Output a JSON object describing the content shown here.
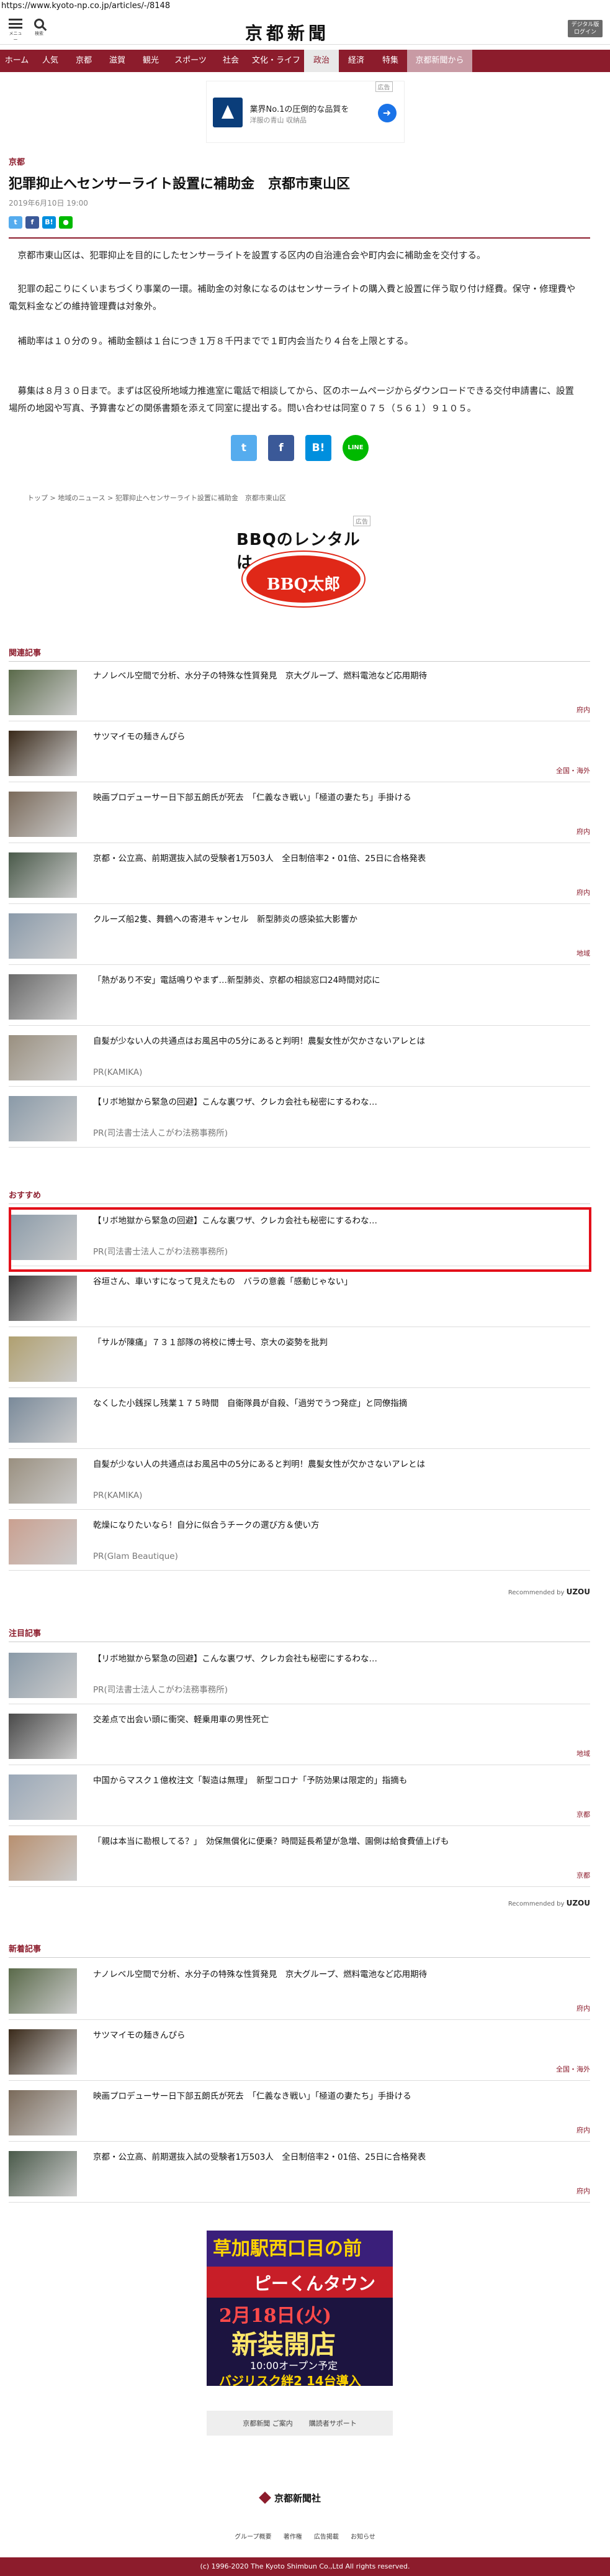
{
  "url": "https://www.kyoto-np.co.jp/articles/-/8148",
  "header": {
    "menu_label": "メニュー",
    "search_label": "検索",
    "logo": "京都新聞",
    "login_line1": "デジタル版",
    "login_line2": "ログイン"
  },
  "nav": [
    {
      "label": "ホーム",
      "w": 54
    },
    {
      "label": "人気",
      "w": 54
    },
    {
      "label": "京都",
      "w": 54
    },
    {
      "label": "滋賀",
      "w": 54
    },
    {
      "label": "観光",
      "w": 54
    },
    {
      "label": "スポーツ",
      "w": 74
    },
    {
      "label": "社会",
      "w": 56
    },
    {
      "label": "文化・ライフ",
      "w": 90
    },
    {
      "label": "政治",
      "w": 56,
      "active": true
    },
    {
      "label": "経済",
      "w": 56
    },
    {
      "label": "特集",
      "w": 54
    },
    {
      "label": "京都新聞から",
      "w": 105,
      "special": true
    }
  ],
  "ad_top": {
    "tag": "広告",
    "line1": "業界No.1の圧倒的な品質を",
    "line2": "洋服の青山 収納品"
  },
  "article": {
    "category": "京都",
    "title": "犯罪抑止へセンサーライト設置に補助金　京都市東山区",
    "date": "2019年6月10日 19:00",
    "paragraphs": [
      "京都市東山区は、犯罪抑止を目的にしたセンサーライトを設置する区内の自治連合会や町内会に補助金を交付する。",
      "犯罪の起こりにくいまちづくり事業の一環。補助金の対象になるのはセンサーライトの購入費と設置に伴う取り付け経費。保守・修理費や電気料金などの維持管理費は対象外。",
      "補助率は１０分の９。補助金額は１台につき１万８千円までで１町内会当たり４台を上限とする。",
      "募集は８月３０日まで。まずは区役所地域力推進室に電話で相談してから、区のホームページからダウンロードできる交付申請書に、設置場所の地図や写真、予算書などの関係書類を添えて同室に提出する。問い合わせは同室０７５（５６１）９１０５。"
    ]
  },
  "share": {
    "twitter": "t",
    "facebook": "f",
    "hatena": "B!",
    "line": "LINE"
  },
  "breadcrumb": [
    "トップ",
    "地域のニュース",
    "犯罪抑止へセンサーライト設置に補助金　京都市東山区"
  ],
  "bbq_ad": {
    "tag": "広告",
    "title": "BBQのレンタルは",
    "brand": "BBQ太郎"
  },
  "related": {
    "heading": "関連記事",
    "items": [
      {
        "text": "ナノレベル空間で分析、水分子の特殊な性質発見　京大グループ、燃料電池など応用期待",
        "tag": "府内",
        "color": "#5a6a4a"
      },
      {
        "text": "サツマイモの麺きんぴら",
        "tag": "全国・海外",
        "color": "#3a2a1a"
      },
      {
        "text": "映画プロデューサー日下部五朗氏が死去　「仁義なき戦い」「極道の妻たち」手掛ける",
        "tag": "府内",
        "color": "#7a6a5a"
      },
      {
        "text": "京都・公立高、前期選抜入試の受験者1万503人　全日制倍率2・01倍、25日に合格発表",
        "tag": "府内",
        "color": "#4a5a4a"
      },
      {
        "text": "クルーズ船2隻、舞鶴への寄港キャンセル　新型肺炎の感染拡大影響か",
        "tag": "地域",
        "color": "#8a9aaa"
      },
      {
        "text": "「熱があり不安」電話鳴りやまず…新型肺炎、京都の相談窓口24時間対応に",
        "tag": "",
        "color": "#6a6a6a"
      },
      {
        "text": "自髪が少ない人の共通点はお風呂中の5分にあると判明！農髪女性が欠かさないアレとは",
        "pr": "PR(KAMIKA)",
        "color": "#9a9080"
      },
      {
        "text": "【リボ地獄から緊急の回避】こんな裏ワザ、クレカ会社も秘密にするわな…",
        "pr": "PR(司法書士法人こがわ法務事務所)",
        "color": "#8a9aa8"
      }
    ]
  },
  "recommend": {
    "heading": "おすすめ",
    "items": [
      {
        "text": "【リボ地獄から緊急の回避】こんな裏ワザ、クレカ会社も秘密にするわな…",
        "pr": "PR(司法書士法人こがわ法務事務所)",
        "color": "#8a9aa8",
        "highlight": true
      },
      {
        "text": "谷垣さん、車いすになって見えたもの　バラの意義「感動じゃない」",
        "color": "#3a3a3a"
      },
      {
        "text": "「サルが陳痛」７３１部隊の将校に博士号、京大の姿勢を批判",
        "color": "#b0a070"
      },
      {
        "text": "なくした小銭探し残業１７５時間　自衛隊員が自殺、「過労でうつ発症」と同僚指摘",
        "color": "#7a8a9a"
      },
      {
        "text": "自髪が少ない人の共通点はお風呂中の5分にあると判明！農髪女性が欠かさないアレとは",
        "pr": "PR(KAMIKA)",
        "color": "#9a9080"
      },
      {
        "text": "乾燥になりたいなら！自分に似合うチークの選び方＆使い方",
        "pr": "PR(Glam Beautique)",
        "color": "#caa090"
      }
    ],
    "reco": "Recommended by",
    "reco_brand": "UZOU"
  },
  "attention": {
    "heading": "注目記事",
    "items": [
      {
        "text": "【リボ地獄から緊急の回避】こんな裏ワザ、クレカ会社も秘密にするわな…",
        "pr": "PR(司法書士法人こがわ法務事務所)",
        "color": "#8a9aa8"
      },
      {
        "text": "交差点で出会い頭に衝突、軽乗用車の男性死亡",
        "tag": "地域",
        "color": "#4a4a4a"
      },
      {
        "text": "中国からマスク１億枚注文「製造は無理」　新型コロナ「予防効果は限定的」指摘も",
        "tag": "京都",
        "color": "#9aa8b8"
      },
      {
        "text": "「親は本当に勘根してる？」　効保無償化に便乗？時間延長希望が急増、園側は給食費値上げも",
        "tag": "京都",
        "color": "#b89070"
      }
    ],
    "reco": "Recommended by",
    "reco_brand": "UZOU"
  },
  "newest": {
    "heading": "新着記事",
    "items": [
      {
        "text": "ナノレベル空間で分析、水分子の特殊な性質発見　京大グループ、燃料電池など応用期待",
        "tag": "府内",
        "color": "#5a6a4a"
      },
      {
        "text": "サツマイモの麺きんぴら",
        "tag": "全国・海外",
        "color": "#3a2a1a"
      },
      {
        "text": "映画プロデューサー日下部五朗氏が死去　「仁義なき戦い」「極道の妻たち」手掛ける",
        "tag": "府内",
        "color": "#7a6a5a"
      },
      {
        "text": "京都・公立高、前期選抜入試の受験者1万503人　全日制倍率2・01倍、25日に合格発表",
        "tag": "府内",
        "color": "#4a5a4a"
      }
    ]
  },
  "bottom_ad": {
    "l1": "草加駅西口目の前",
    "l2": "ピーくんタウン",
    "l3": "2月18日(火)",
    "l4": "新装開店",
    "l5": "10:00オープン予定",
    "l6": "バジリスク絆2 14台導入"
  },
  "footer": {
    "link1": "京都新聞 ご案内",
    "link2": "購読者サポート",
    "logo": "京都新聞社",
    "links": [
      "グループ概要",
      "著作権",
      "広告掲載",
      "お知らせ"
    ],
    "copyright": "(c) 1996-2020 The Kyoto Shimbun Co.,Ltd All rights reserved."
  }
}
